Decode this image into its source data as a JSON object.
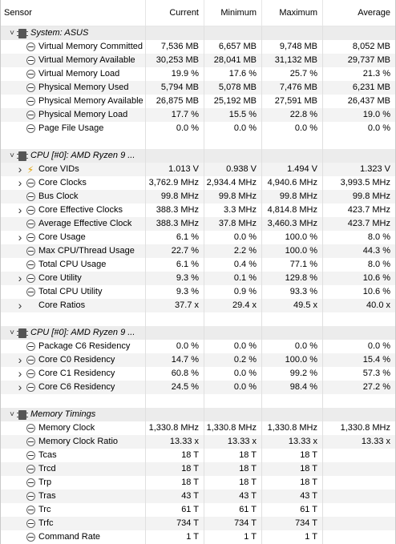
{
  "header": {
    "sensor": "Sensor",
    "current": "Current",
    "minimum": "Minimum",
    "maximum": "Maximum",
    "average": "Average"
  },
  "groups": [
    {
      "title": "System: ASUS",
      "rows": [
        {
          "label": "Virtual Memory Committed",
          "cur": "7,536 MB",
          "min": "6,657 MB",
          "max": "9,748 MB",
          "avg": "8,052 MB",
          "icon": "gauge",
          "indent": 0,
          "expand": false
        },
        {
          "label": "Virtual Memory Available",
          "cur": "30,253 MB",
          "min": "28,041 MB",
          "max": "31,132 MB",
          "avg": "29,737 MB",
          "icon": "gauge",
          "indent": 0,
          "expand": false
        },
        {
          "label": "Virtual Memory Load",
          "cur": "19.9 %",
          "min": "17.6 %",
          "max": "25.7 %",
          "avg": "21.3 %",
          "icon": "gauge",
          "indent": 0,
          "expand": false
        },
        {
          "label": "Physical Memory Used",
          "cur": "5,794 MB",
          "min": "5,078 MB",
          "max": "7,476 MB",
          "avg": "6,231 MB",
          "icon": "gauge",
          "indent": 0,
          "expand": false
        },
        {
          "label": "Physical Memory Available",
          "cur": "26,875 MB",
          "min": "25,192 MB",
          "max": "27,591 MB",
          "avg": "26,437 MB",
          "icon": "gauge",
          "indent": 0,
          "expand": false
        },
        {
          "label": "Physical Memory Load",
          "cur": "17.7 %",
          "min": "15.5 %",
          "max": "22.8 %",
          "avg": "19.0 %",
          "icon": "gauge",
          "indent": 0,
          "expand": false
        },
        {
          "label": "Page File Usage",
          "cur": "0.0 %",
          "min": "0.0 %",
          "max": "0.0 %",
          "avg": "0.0 %",
          "icon": "gauge",
          "indent": 0,
          "expand": false
        }
      ]
    },
    {
      "title": "CPU [#0]: AMD Ryzen 9 ...",
      "rows": [
        {
          "label": "Core VIDs",
          "cur": "1.013 V",
          "min": "0.938 V",
          "max": "1.494 V",
          "avg": "1.323 V",
          "icon": "bolt",
          "indent": 1,
          "expand": true
        },
        {
          "label": "Core Clocks",
          "cur": "3,762.9 MHz",
          "min": "2,934.4 MHz",
          "max": "4,940.6 MHz",
          "avg": "3,993.5 MHz",
          "icon": "gauge",
          "indent": 1,
          "expand": true
        },
        {
          "label": "Bus Clock",
          "cur": "99.8 MHz",
          "min": "99.8 MHz",
          "max": "99.8 MHz",
          "avg": "99.8 MHz",
          "icon": "gauge",
          "indent": 0,
          "expand": false
        },
        {
          "label": "Core Effective Clocks",
          "cur": "388.3 MHz",
          "min": "3.3 MHz",
          "max": "4,814.8 MHz",
          "avg": "423.7 MHz",
          "icon": "gauge",
          "indent": 1,
          "expand": true
        },
        {
          "label": "Average Effective Clock",
          "cur": "388.3 MHz",
          "min": "37.8 MHz",
          "max": "3,460.3 MHz",
          "avg": "423.7 MHz",
          "icon": "gauge",
          "indent": 0,
          "expand": false
        },
        {
          "label": "Core Usage",
          "cur": "6.1 %",
          "min": "0.0 %",
          "max": "100.0 %",
          "avg": "8.0 %",
          "icon": "gauge",
          "indent": 1,
          "expand": true
        },
        {
          "label": "Max CPU/Thread Usage",
          "cur": "22.7 %",
          "min": "2.2 %",
          "max": "100.0 %",
          "avg": "44.3 %",
          "icon": "gauge",
          "indent": 0,
          "expand": false
        },
        {
          "label": "Total CPU Usage",
          "cur": "6.1 %",
          "min": "0.4 %",
          "max": "77.1 %",
          "avg": "8.0 %",
          "icon": "gauge",
          "indent": 0,
          "expand": false
        },
        {
          "label": "Core Utility",
          "cur": "9.3 %",
          "min": "0.1 %",
          "max": "129.8 %",
          "avg": "10.6 %",
          "icon": "gauge",
          "indent": 1,
          "expand": true
        },
        {
          "label": "Total CPU Utility",
          "cur": "9.3 %",
          "min": "0.9 %",
          "max": "93.3 %",
          "avg": "10.6 %",
          "icon": "gauge",
          "indent": 0,
          "expand": false
        },
        {
          "label": "Core Ratios",
          "cur": "37.7 x",
          "min": "29.4 x",
          "max": "49.5 x",
          "avg": "40.0 x",
          "icon": "none",
          "indent": 1,
          "expand": true
        }
      ]
    },
    {
      "title": "CPU [#0]: AMD Ryzen 9 ...",
      "rows": [
        {
          "label": "Package C6 Residency",
          "cur": "0.0 %",
          "min": "0.0 %",
          "max": "0.0 %",
          "avg": "0.0 %",
          "icon": "gauge",
          "indent": 0,
          "expand": false
        },
        {
          "label": "Core C0 Residency",
          "cur": "14.7 %",
          "min": "0.2 %",
          "max": "100.0 %",
          "avg": "15.4 %",
          "icon": "gauge",
          "indent": 1,
          "expand": true
        },
        {
          "label": "Core C1 Residency",
          "cur": "60.8 %",
          "min": "0.0 %",
          "max": "99.2 %",
          "avg": "57.3 %",
          "icon": "gauge",
          "indent": 1,
          "expand": true
        },
        {
          "label": "Core C6 Residency",
          "cur": "24.5 %",
          "min": "0.0 %",
          "max": "98.4 %",
          "avg": "27.2 %",
          "icon": "gauge",
          "indent": 1,
          "expand": true
        }
      ]
    },
    {
      "title": "Memory Timings",
      "rows": [
        {
          "label": "Memory Clock",
          "cur": "1,330.8 MHz",
          "min": "1,330.8 MHz",
          "max": "1,330.8 MHz",
          "avg": "1,330.8 MHz",
          "icon": "gauge",
          "indent": 0,
          "expand": false
        },
        {
          "label": "Memory Clock Ratio",
          "cur": "13.33 x",
          "min": "13.33 x",
          "max": "13.33 x",
          "avg": "13.33 x",
          "icon": "gauge",
          "indent": 0,
          "expand": false
        },
        {
          "label": "Tcas",
          "cur": "18 T",
          "min": "18 T",
          "max": "18 T",
          "avg": "",
          "icon": "gauge",
          "indent": 0,
          "expand": false
        },
        {
          "label": "Trcd",
          "cur": "18 T",
          "min": "18 T",
          "max": "18 T",
          "avg": "",
          "icon": "gauge",
          "indent": 0,
          "expand": false
        },
        {
          "label": "Trp",
          "cur": "18 T",
          "min": "18 T",
          "max": "18 T",
          "avg": "",
          "icon": "gauge",
          "indent": 0,
          "expand": false
        },
        {
          "label": "Tras",
          "cur": "43 T",
          "min": "43 T",
          "max": "43 T",
          "avg": "",
          "icon": "gauge",
          "indent": 0,
          "expand": false
        },
        {
          "label": "Trc",
          "cur": "61 T",
          "min": "61 T",
          "max": "61 T",
          "avg": "",
          "icon": "gauge",
          "indent": 0,
          "expand": false
        },
        {
          "label": "Trfc",
          "cur": "734 T",
          "min": "734 T",
          "max": "734 T",
          "avg": "",
          "icon": "gauge",
          "indent": 0,
          "expand": false
        },
        {
          "label": "Command Rate",
          "cur": "1 T",
          "min": "1 T",
          "max": "1 T",
          "avg": "",
          "icon": "gauge",
          "indent": 0,
          "expand": false
        }
      ]
    }
  ]
}
